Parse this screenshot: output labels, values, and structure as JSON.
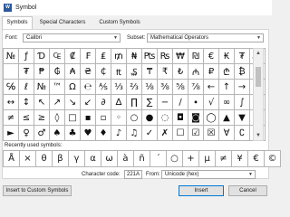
{
  "window": {
    "title": "Symbol",
    "icon": "word-app-icon"
  },
  "tabs": [
    {
      "label": "Symbols",
      "active": true
    },
    {
      "label": "Special Characters",
      "active": false
    },
    {
      "label": "Custom Symbols",
      "active": false
    }
  ],
  "font": {
    "label": "Font:",
    "value": "Calibri"
  },
  "subset": {
    "label": "Subset:",
    "value": "Mathematical Operators"
  },
  "symbol_grid": [
    [
      "№",
      "ƒ",
      "Ɗ",
      "₠",
      "₡",
      "₣",
      "₤",
      "₥",
      "₦",
      "₧",
      "₨",
      "₩",
      "₪",
      "€",
      "₭",
      "₮",
      "₯"
    ],
    [
      "\t",
      "₮",
      "₱",
      "₲",
      "₳",
      "₴",
      "₵",
      "₶",
      "₷",
      "₸",
      "₹",
      "₺",
      "₼",
      "₽",
      "₾",
      "₿",
      "⃀"
    ],
    [
      "℅",
      "ℓ",
      "№",
      "™",
      "Ω",
      "℮",
      "⅍",
      "⅓",
      "⅔",
      "⅛",
      "⅜",
      "⅝",
      "⅞",
      "←",
      "↑",
      "→",
      "↓"
    ],
    [
      "↔",
      "↕",
      "↖",
      "↗",
      "↘",
      "↙",
      "∂",
      "∆",
      "∏",
      "∑",
      "−",
      "∕",
      "∙",
      "√",
      "∞",
      "∫",
      "≈"
    ],
    [
      "≠",
      "≤",
      "≥",
      "◊",
      "□",
      "▪",
      "▫",
      "◦",
      "○",
      "●",
      "◌",
      "◘",
      "◙",
      "◯",
      "▲",
      "▼",
      "◄"
    ],
    [
      "►",
      "♀",
      "♂",
      "♠",
      "♣",
      "♥",
      "♦",
      "♪",
      "♫",
      "✓",
      "✗",
      "☐",
      "☑",
      "☒",
      "∀",
      "∁",
      "∃"
    ]
  ],
  "recent_symbols": [
    "Å",
    "×",
    "θ",
    "β",
    "γ",
    "α",
    "ω",
    "à",
    "ñ",
    "ˊ",
    "○",
    "+",
    "µ",
    "≠",
    "¥",
    "€",
    "©"
  ],
  "labels": {
    "recent": "Recently used symbols:",
    "character_code": "Character code:",
    "from": "From:"
  },
  "character_code": "221A",
  "from": "Unicode (hex)",
  "buttons": {
    "insert_custom": "Insert to Custom Symbols",
    "insert": "Insert",
    "cancel": "Cancel"
  }
}
